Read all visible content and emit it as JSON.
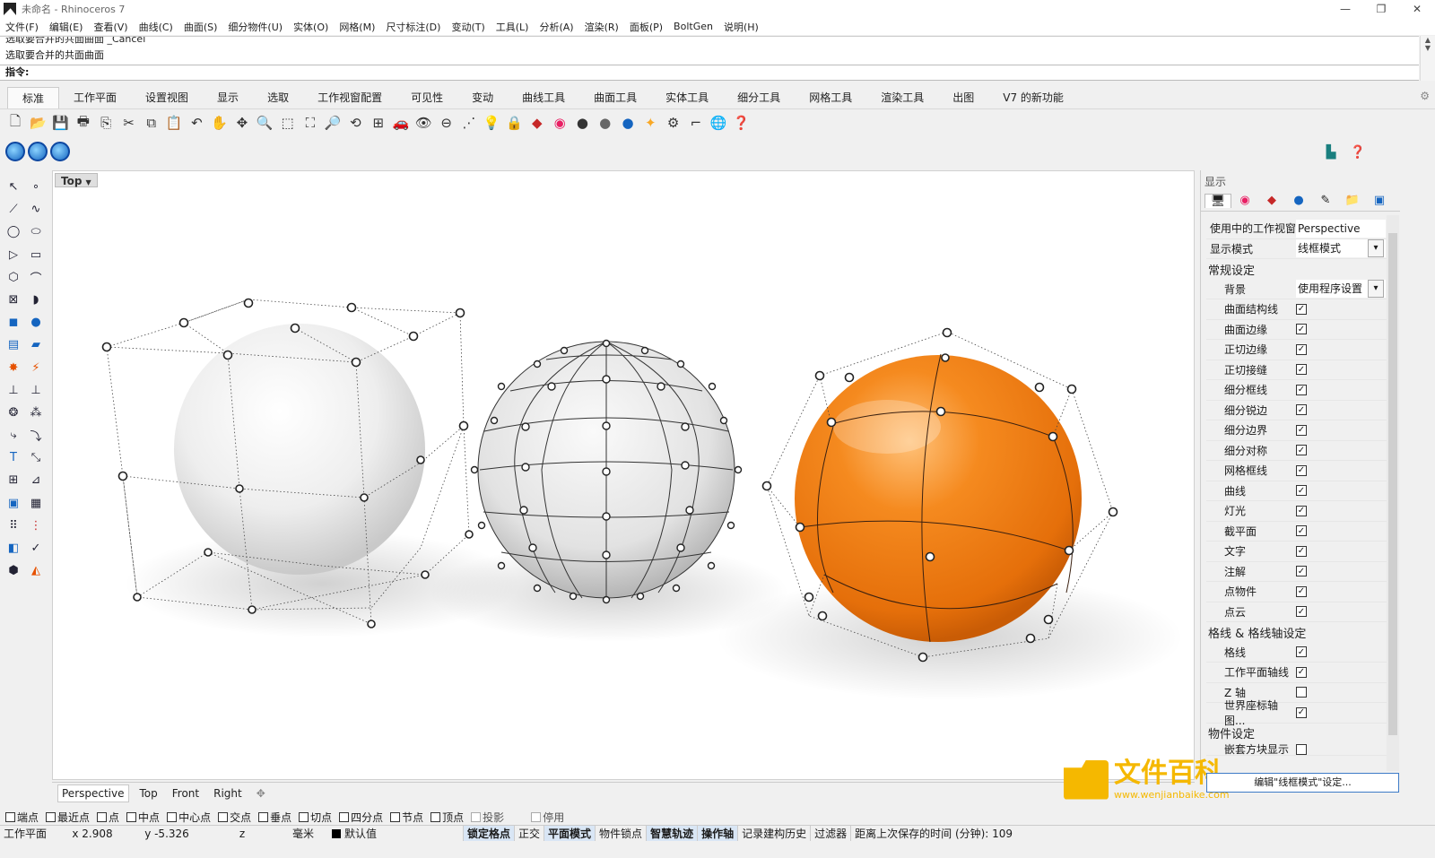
{
  "window": {
    "title": "未命名 - Rhinoceros 7",
    "controls": [
      "—",
      "❐",
      "✕"
    ]
  },
  "menubar": [
    "文件(F)",
    "编辑(E)",
    "查看(V)",
    "曲线(C)",
    "曲面(S)",
    "细分物件(U)",
    "实体(O)",
    "网格(M)",
    "尺寸标注(D)",
    "变动(T)",
    "工具(L)",
    "分析(A)",
    "渲染(R)",
    "面板(P)",
    "BoltGen",
    "说明(H)"
  ],
  "command": {
    "history_line1": "选取要合并的共面曲面 _Cancel",
    "history_line2": "选取要合并的共面曲面",
    "prompt": "指令:"
  },
  "tabs": [
    "标准",
    "工作平面",
    "设置视图",
    "显示",
    "选取",
    "工作视窗配置",
    "可见性",
    "变动",
    "曲线工具",
    "曲面工具",
    "实体工具",
    "细分工具",
    "网格工具",
    "渲染工具",
    "出图",
    "V7 的新功能"
  ],
  "viewport": {
    "label": "Top",
    "tabs": [
      "Perspective",
      "Top",
      "Front",
      "Right"
    ],
    "add_tab_icon": "✥"
  },
  "osnap": [
    {
      "label": "端点",
      "checked": false
    },
    {
      "label": "最近点",
      "checked": false
    },
    {
      "label": "点",
      "checked": false
    },
    {
      "label": "中点",
      "checked": false
    },
    {
      "label": "中心点",
      "checked": false
    },
    {
      "label": "交点",
      "checked": false
    },
    {
      "label": "垂点",
      "checked": false
    },
    {
      "label": "切点",
      "checked": false
    },
    {
      "label": "四分点",
      "checked": false
    },
    {
      "label": "节点",
      "checked": false
    },
    {
      "label": "顶点",
      "checked": false
    },
    {
      "label": "投影",
      "checked": false
    },
    {
      "label": "停用",
      "checked": false
    }
  ],
  "statusbar": {
    "cplane": "工作平面",
    "x": "x 2.908",
    "y": "y -5.326",
    "z": "z",
    "unit": "毫米",
    "layer": "默认值",
    "grid_snap": "锁定格点",
    "ortho": "正交",
    "planar": "平面模式",
    "osnap": "物件锁点",
    "smarttrack": "智慧轨迹",
    "gumball": "操作轴",
    "history": "记录建构历史",
    "filter": "过滤器",
    "autosave": "距离上次保存的时间 (分钟): 109"
  },
  "panel": {
    "title": "显示",
    "active_viewport_label": "使用中的工作视窗",
    "active_viewport_value": "Perspective",
    "display_mode_label": "显示模式",
    "display_mode_value": "线框模式",
    "general_section": "常规设定",
    "background_label": "背景",
    "background_value": "使用程序设置",
    "general_items": [
      {
        "label": "曲面结构线",
        "checked": true
      },
      {
        "label": "曲面边缘",
        "checked": true
      },
      {
        "label": "正切边缘",
        "checked": true
      },
      {
        "label": "正切接缝",
        "checked": true
      },
      {
        "label": "细分框线",
        "checked": true
      },
      {
        "label": "细分锐边",
        "checked": true
      },
      {
        "label": "细分边界",
        "checked": true
      },
      {
        "label": "细分对称",
        "checked": true
      },
      {
        "label": "网格框线",
        "checked": true
      },
      {
        "label": "曲线",
        "checked": true
      },
      {
        "label": "灯光",
        "checked": true
      },
      {
        "label": "截平面",
        "checked": true
      },
      {
        "label": "文字",
        "checked": true
      },
      {
        "label": "注解",
        "checked": true
      },
      {
        "label": "点物件",
        "checked": true
      },
      {
        "label": "点云",
        "checked": true
      }
    ],
    "grid_section": "格线 & 格线轴设定",
    "grid_items": [
      {
        "label": "格线",
        "checked": true
      },
      {
        "label": "工作平面轴线",
        "checked": true
      },
      {
        "label": "Z 轴",
        "checked": false
      },
      {
        "label": "世界座标轴图...",
        "checked": true
      }
    ],
    "object_section": "物件设定",
    "object_item": "嵌套方块显示",
    "edit_button": "编辑\"线框模式\"设定..."
  },
  "watermark": {
    "title": "文件百科",
    "url": "www.wenjianbaike.com"
  },
  "colors": {
    "accent": "#3d7bc7",
    "orange_sphere": "#ef7d1a",
    "watermark": "#f5b800"
  }
}
